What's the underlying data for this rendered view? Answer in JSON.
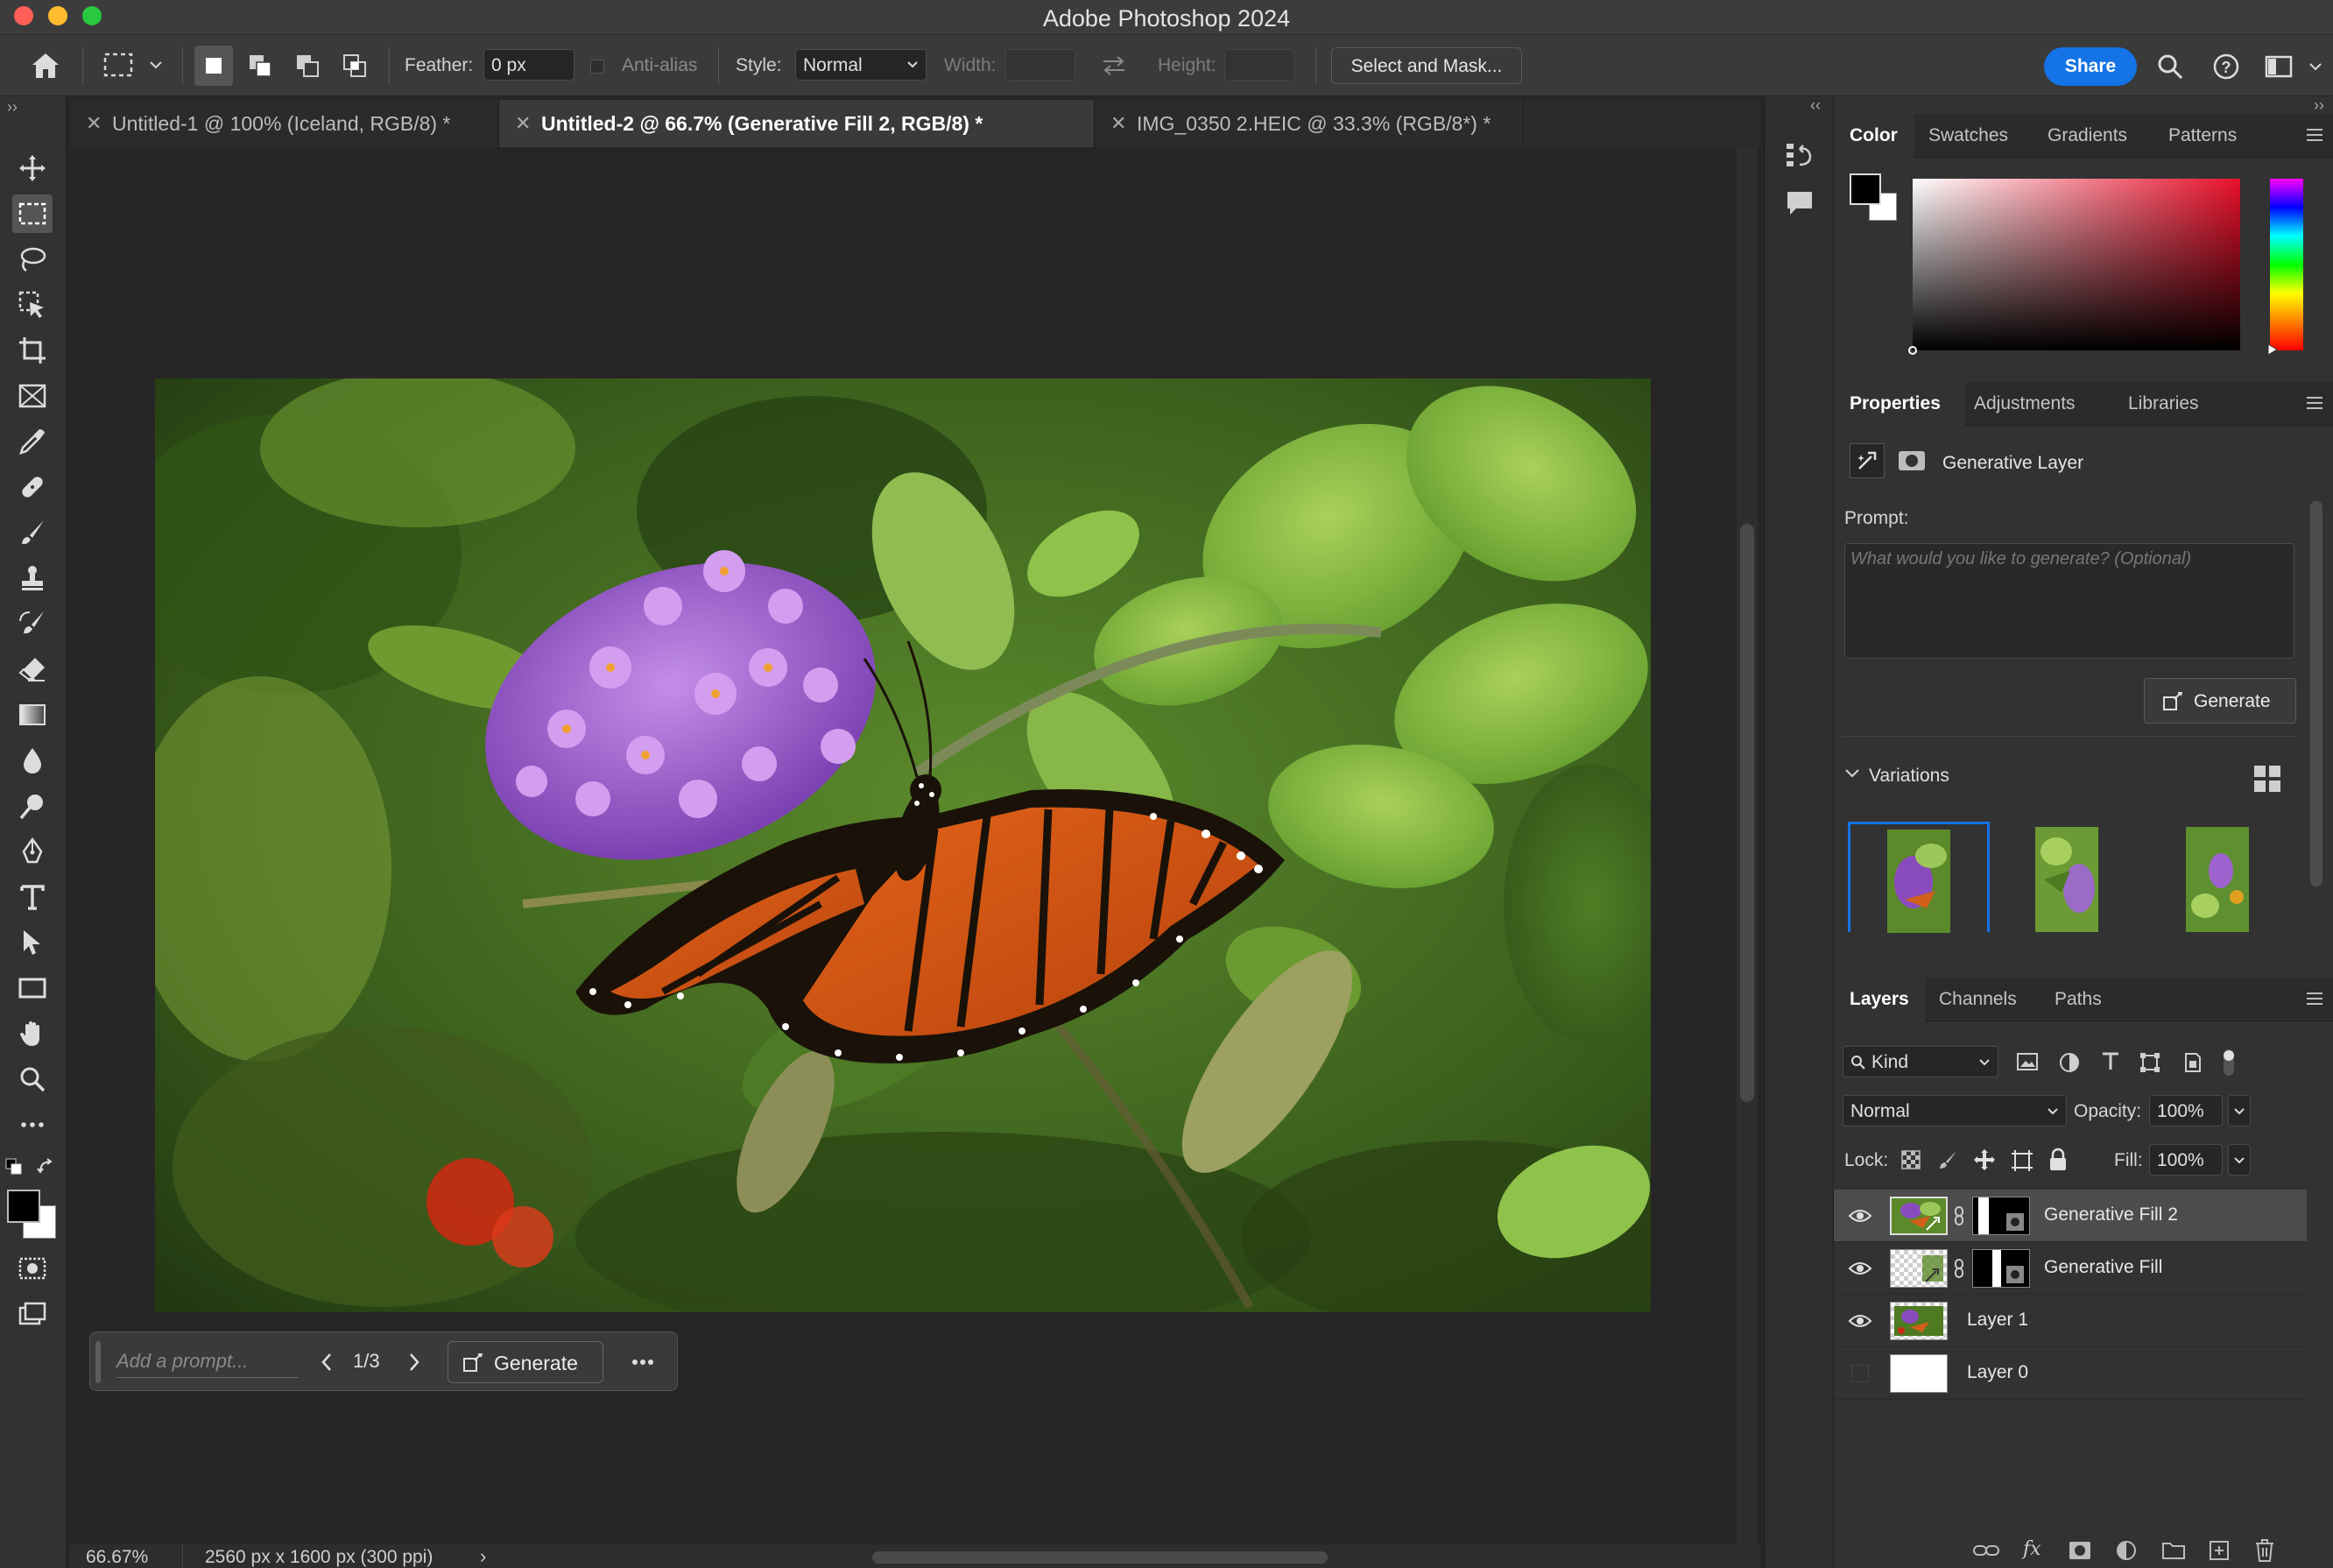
{
  "app": {
    "title": "Adobe Photoshop 2024"
  },
  "options_bar": {
    "feather_label": "Feather:",
    "feather_value": "0 px",
    "anti_alias_label": "Anti-alias",
    "style_label": "Style:",
    "style_value": "Normal",
    "width_label": "Width:",
    "height_label": "Height:",
    "select_and_mask_label": "Select and Mask...",
    "share_label": "Share",
    "accent_color": "#1473e6"
  },
  "tabs": [
    {
      "label": "Untitled-1 @ 100% (Iceland, RGB/8) *",
      "active": false
    },
    {
      "label": "Untitled-2 @ 66.7% (Generative Fill 2, RGB/8) *",
      "active": true
    },
    {
      "label": "IMG_0350 2.HEIC @ 33.3% (RGB/8*) *",
      "active": false
    }
  ],
  "contextual_bar": {
    "prompt_placeholder": "Add a prompt...",
    "variation_counter": "1/3",
    "generate_label": "Generate"
  },
  "status_bar": {
    "zoom": "66.67%",
    "doc_info": "2560 px x 1600 px (300 ppi)"
  },
  "color_panel": {
    "tabs": [
      "Color",
      "Swatches",
      "Gradients",
      "Patterns"
    ],
    "active_tab": "Color",
    "foreground": "#000000",
    "background": "#ffffff",
    "hue_color": "#e8102a"
  },
  "properties_panel": {
    "tabs": [
      "Properties",
      "Adjustments",
      "Libraries"
    ],
    "active_tab": "Properties",
    "layer_type": "Generative Layer",
    "prompt_label": "Prompt:",
    "prompt_placeholder": "What would you like to generate? (Optional)",
    "generate_label": "Generate",
    "variations_label": "Variations",
    "selected_variation": 1
  },
  "layers_panel": {
    "tabs": [
      "Layers",
      "Channels",
      "Paths"
    ],
    "active_tab": "Layers",
    "filter_label": "Kind",
    "blend_mode": "Normal",
    "opacity_label": "Opacity:",
    "opacity_value": "100%",
    "lock_label": "Lock:",
    "fill_label": "Fill:",
    "fill_value": "100%",
    "layers": [
      {
        "name": "Generative Fill 2",
        "visible": true,
        "selected": true
      },
      {
        "name": "Generative Fill",
        "visible": true,
        "selected": false
      },
      {
        "name": "Layer 1",
        "visible": true,
        "selected": false
      },
      {
        "name": "Layer 0",
        "visible": false,
        "selected": false
      }
    ]
  }
}
